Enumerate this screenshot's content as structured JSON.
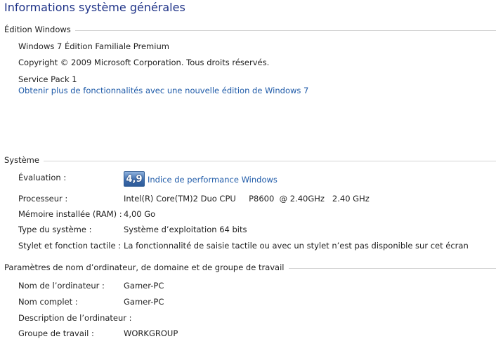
{
  "page": {
    "title": "Informations système générales"
  },
  "edition": {
    "header": "Édition Windows",
    "name": "Windows 7 Édition Familiale Premium",
    "copyright": "Copyright © 2009 Microsoft Corporation. Tous droits réservés.",
    "service_pack": "Service Pack 1",
    "upgrade_link": "Obtenir plus de fonctionnalités avec une nouvelle édition de Windows 7"
  },
  "system": {
    "header": "Système",
    "rating_label": "Évaluation :",
    "rating_score": "4,9",
    "rating_link": "Indice de performance Windows",
    "processor_label": "Processeur :",
    "processor_value": "Intel(R) Core(TM)2 Duo CPU     P8600  @ 2.40GHz   2.40 GHz",
    "memory_label": "Mémoire installée (RAM) :",
    "memory_value": "4,00 Go",
    "type_label": "Type du système :",
    "type_value": "Système d’exploitation 64 bits",
    "pen_label": "Stylet et fonction tactile :",
    "pen_value": "La fonctionnalité de saisie tactile ou avec un stylet n’est pas disponible sur cet écran"
  },
  "computer": {
    "header": "Paramètres de nom d’ordinateur, de domaine et de groupe de travail",
    "name_label": "Nom de l’ordinateur :",
    "name_value": "Gamer-PC",
    "fullname_label": "Nom complet :",
    "fullname_value": "Gamer-PC",
    "description_label": "Description de l’ordinateur :",
    "description_value": "",
    "workgroup_label": "Groupe de travail :",
    "workgroup_value": "WORKGROUP"
  },
  "colors": {
    "title": "#1e3287",
    "link": "#1e5aa8",
    "rule": "#d4d4d4"
  }
}
